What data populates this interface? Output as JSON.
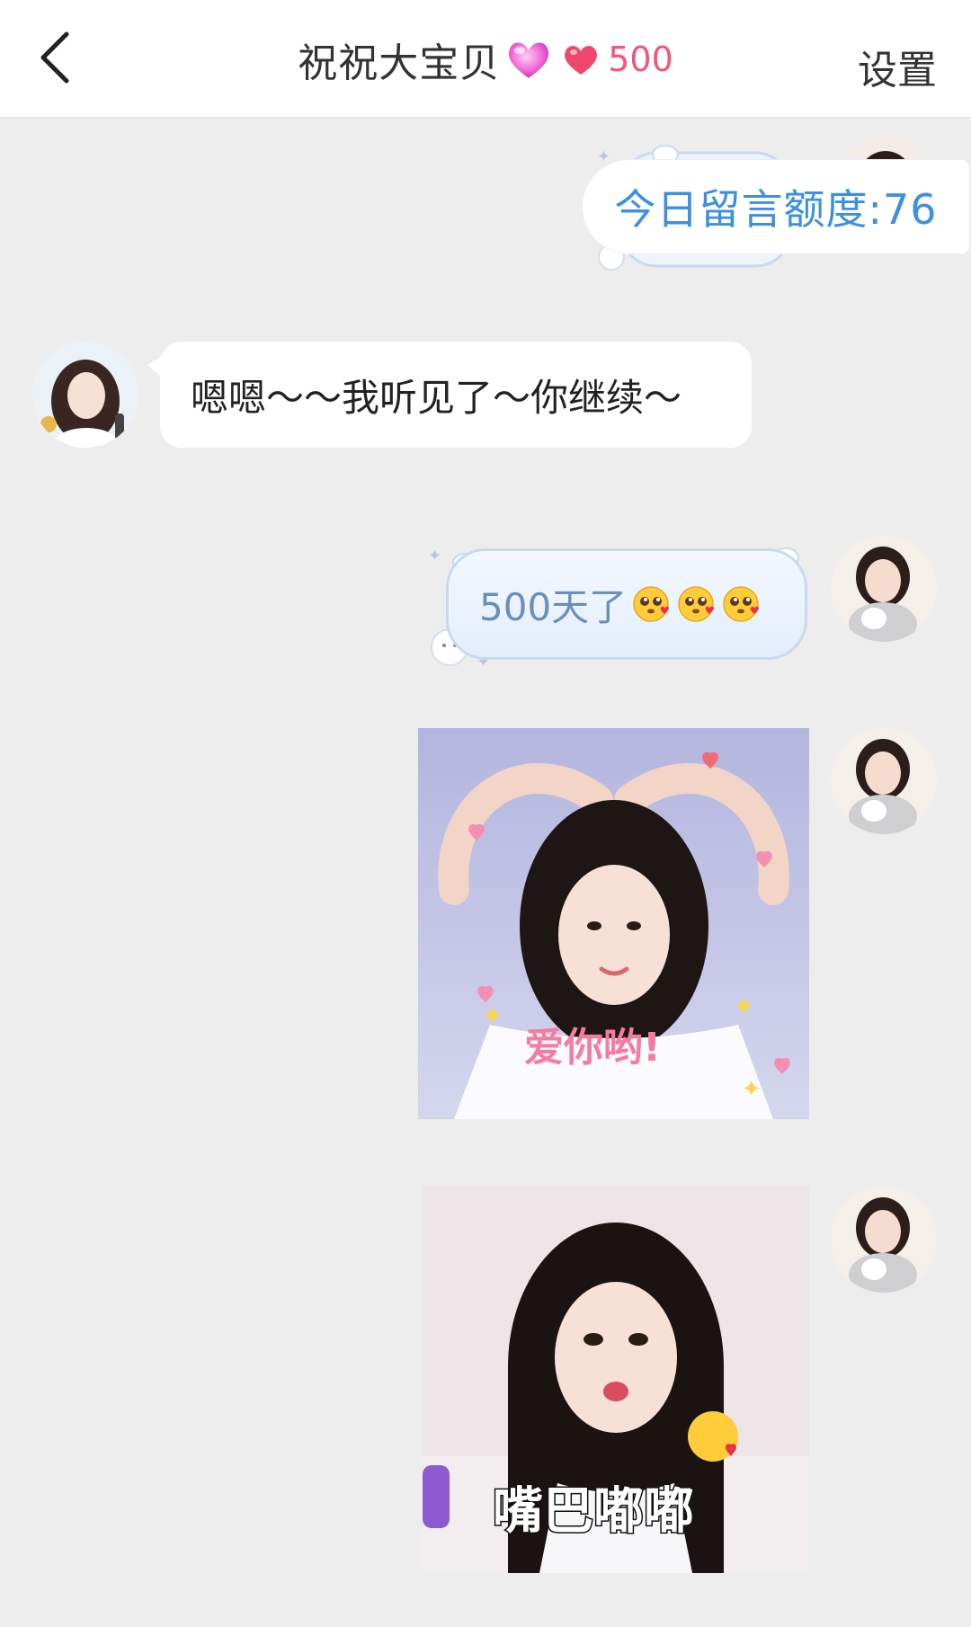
{
  "header": {
    "title": "祝祝大宝贝",
    "intimacy_count": "500",
    "settings_label": "设置"
  },
  "messages": {
    "quota": "今日留言额度:76",
    "incoming_text": "嗯嗯～～我听见了～你继续～",
    "outgoing_text": "500天了",
    "photo1_caption": "爱你哟!",
    "photo2_caption": "嘴巴嘟嘟"
  },
  "colors": {
    "accent_blue": "#3d8fe0",
    "heart_pink": "#f0577a",
    "background": "#ededed"
  },
  "icons": {
    "back": "chevron-left-icon",
    "heart_glow": "pink-heart-icon",
    "heart_red": "red-heart-icon",
    "emoji": "pleading-face-with-hearts-icon"
  }
}
